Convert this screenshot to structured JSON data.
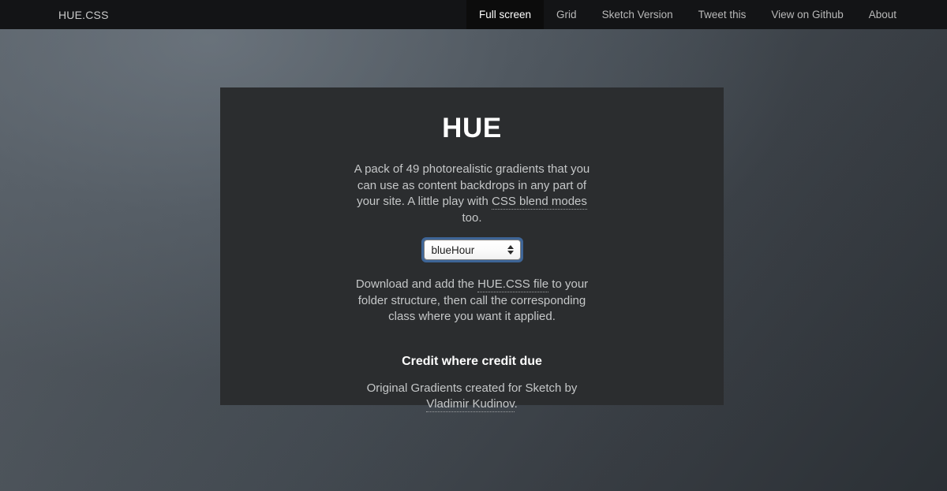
{
  "nav": {
    "brand": "HUE.CSS",
    "items": [
      {
        "label": "Full screen",
        "name": "nav-item-full-screen",
        "active": true
      },
      {
        "label": "Grid",
        "name": "nav-item-grid",
        "active": false
      },
      {
        "label": "Sketch Version",
        "name": "nav-item-sketch-version",
        "active": false
      },
      {
        "label": "Tweet this",
        "name": "nav-item-tweet-this",
        "active": false
      },
      {
        "label": "View on Github",
        "name": "nav-item-view-on-github",
        "active": false
      },
      {
        "label": "About",
        "name": "nav-item-about",
        "active": false
      }
    ]
  },
  "card": {
    "title": "HUE",
    "intro": {
      "before_link": "A pack of 49 photorealistic gradients that you can use as content backdrops in any part of your site. A little play with ",
      "link": "CSS blend modes",
      "after_link": " too."
    },
    "select": {
      "value": "blueHour",
      "options": [
        "blueHour"
      ],
      "stepper_up_icon": "triangle-up-icon",
      "stepper_down_icon": "triangle-down-icon"
    },
    "instructions": {
      "before_link": "Download and add the ",
      "link": "HUE.CSS file",
      "after_link": " to your folder structure, then call the corresponding class where you want it applied."
    },
    "credit": {
      "heading": "Credit where credit due",
      "before_link": "Original Gradients created for Sketch by ",
      "link": "Vladimir Kudinov",
      "after_link": "."
    }
  },
  "colors": {
    "nav_bg": "#131416",
    "nav_active_bg": "#0c0c0c",
    "card_bg": "#2b2d2f",
    "body_text": "#c5c7c8",
    "heading_text": "#ffffff",
    "focus_ring": "#4b88d8",
    "backdrop_light": "#585f66",
    "backdrop_dark": "#2b3035"
  }
}
